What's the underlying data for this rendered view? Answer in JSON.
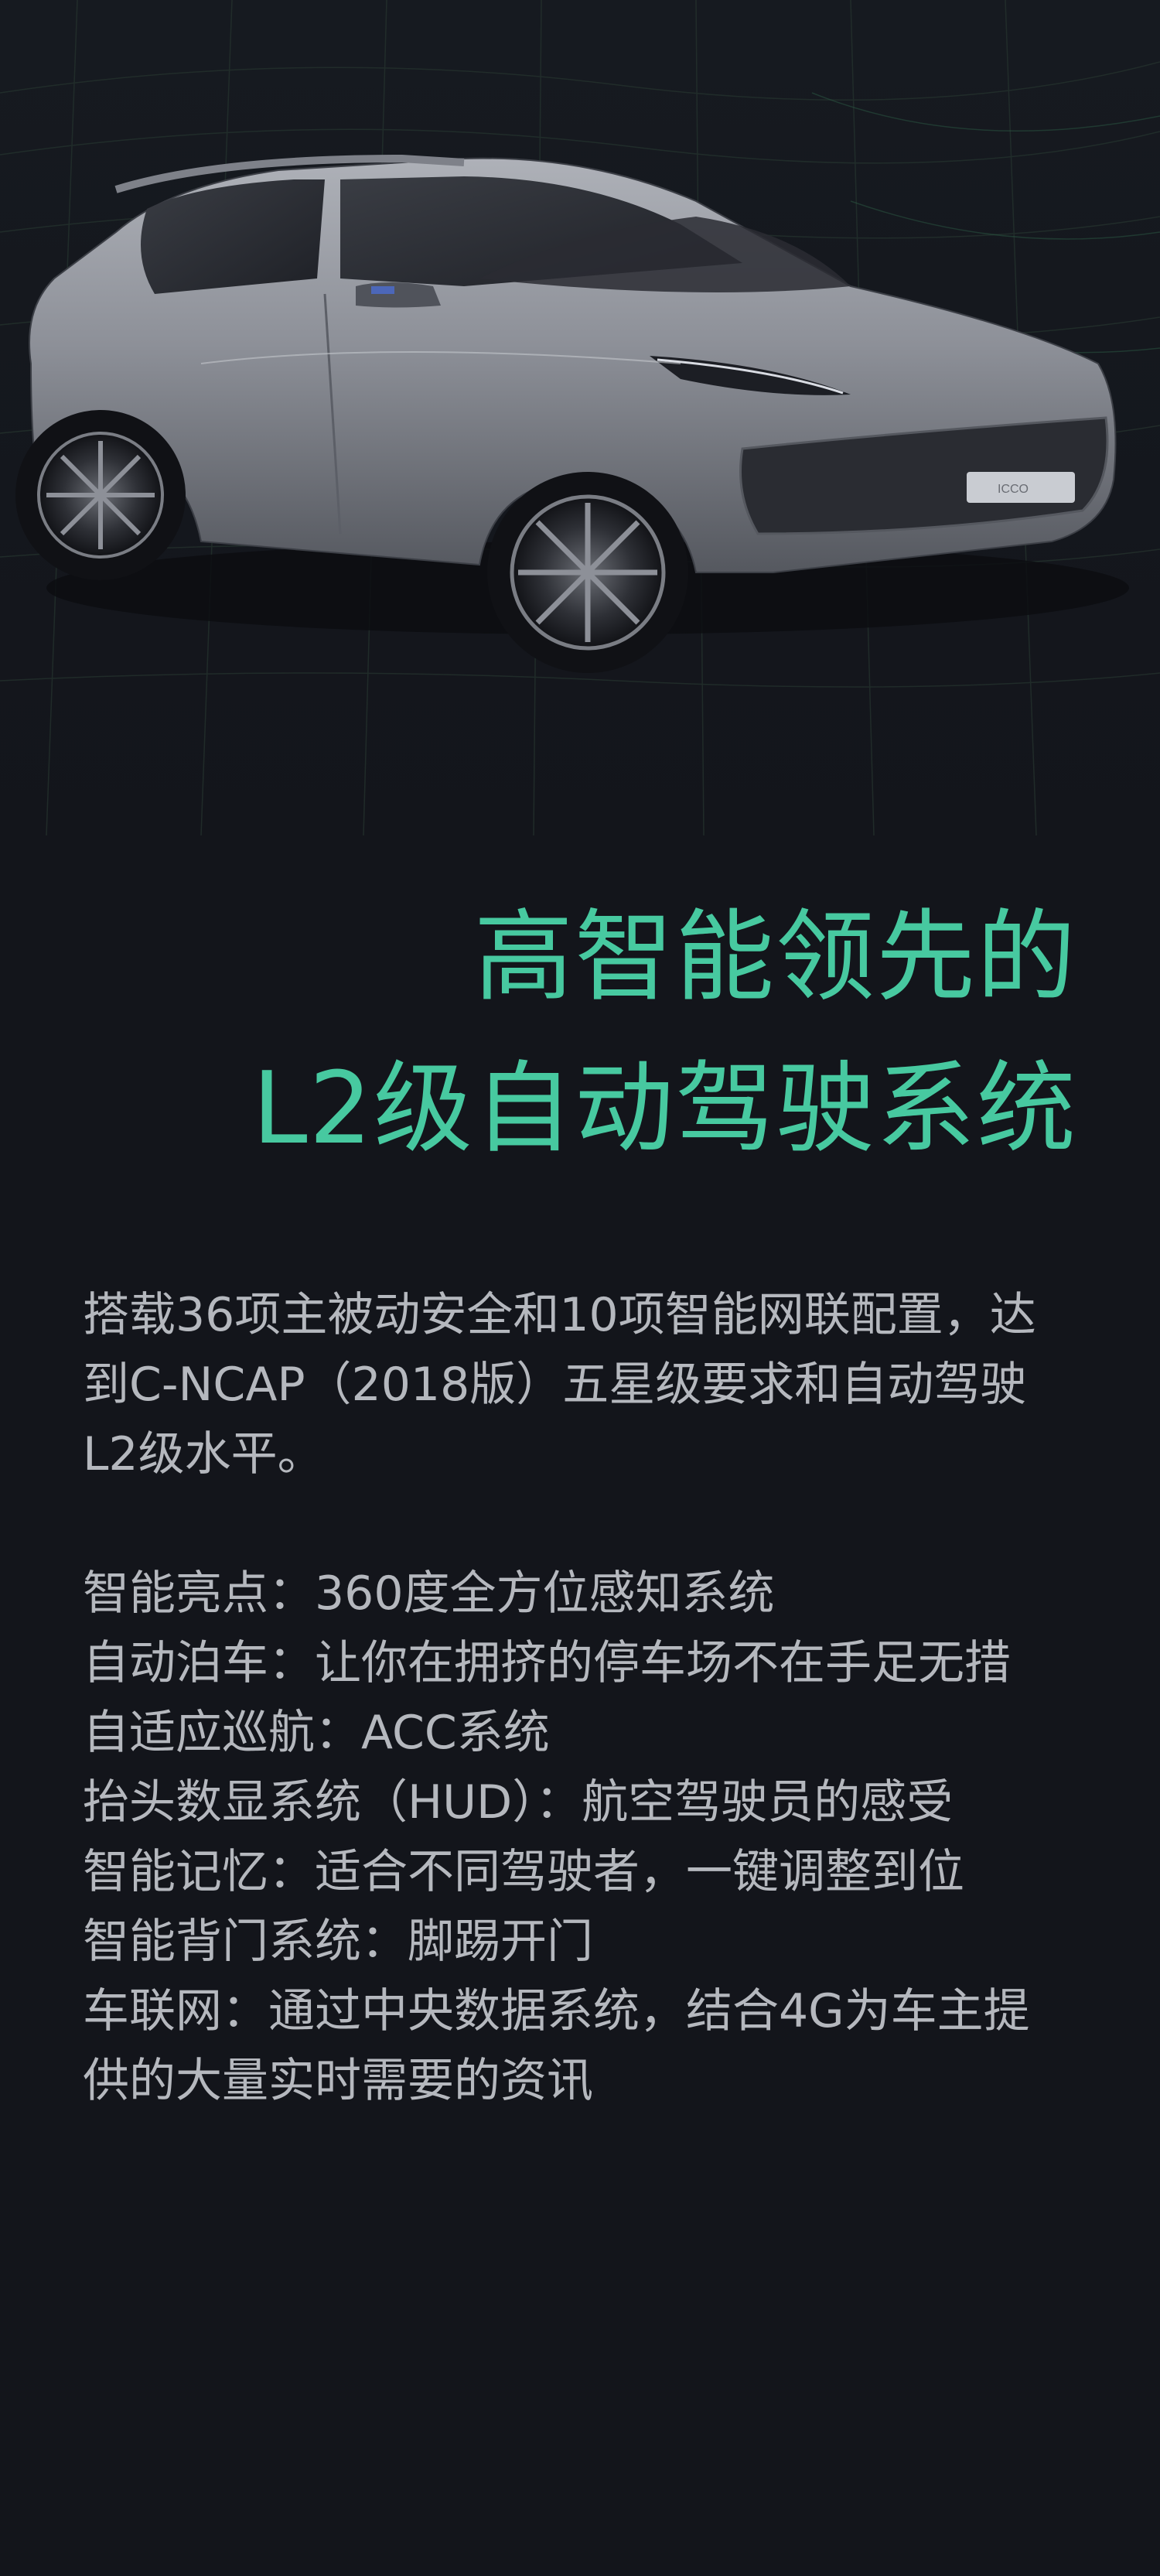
{
  "hero": {
    "image_alt": "SUV concept car, silver-grey, on dark mesh background",
    "grille_badge": "ICCO"
  },
  "headline": {
    "line1": "高智能领先的",
    "line2": "L2级自动驾驶系统"
  },
  "intro": {
    "line1": "搭载36项主被动安全和10项智能网联配置，达",
    "line2": "到C-NCAP（2018版）五星级要求和自动驾驶",
    "line3": "L2级水平。"
  },
  "features": [
    {
      "text": "智能亮点：360度全方位感知系统"
    },
    {
      "text": "自动泊车：让你在拥挤的停车场不在手足无措"
    },
    {
      "text": "自适应巡航：ACC系统"
    },
    {
      "text": "抬头数显系统（HUD）：航空驾驶员的感受"
    },
    {
      "text": "智能记忆：适合不同驾驶者，一键调整到位"
    },
    {
      "text": "智能背门系统：脚踢开门"
    },
    {
      "text": "车联网：通过中央数据系统，结合4G为车主提"
    },
    {
      "text": "供的大量实时需要的资讯"
    }
  ],
  "colors": {
    "background": "#13151b",
    "accent": "#47c9a0",
    "body_text": "#b5b8be"
  }
}
